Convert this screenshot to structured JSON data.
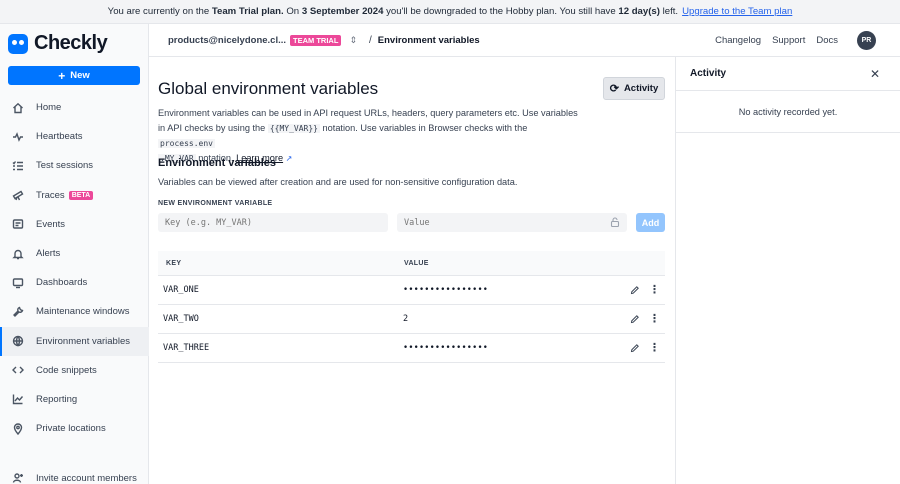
{
  "banner": {
    "t1": "You are currently on the",
    "plan": "Team Trial plan.",
    "t2": "On",
    "date": "3 September 2024",
    "t3": "you'll be downgraded to the Hobby plan. You still have",
    "days": "12 day(s)",
    "t4": "left.",
    "link": "Upgrade to the Team plan"
  },
  "brand": {
    "name": "Checkly"
  },
  "sidebar": {
    "new_label": "New",
    "items": [
      {
        "label": "Home",
        "icon": "home-icon"
      },
      {
        "label": "Heartbeats",
        "icon": "pulse-icon"
      },
      {
        "label": "Test sessions",
        "icon": "list-check-icon"
      },
      {
        "label": "Traces",
        "icon": "telescope-icon",
        "badge": "BETA"
      },
      {
        "label": "Events",
        "icon": "events-icon"
      },
      {
        "label": "Alerts",
        "icon": "bell-icon"
      },
      {
        "label": "Dashboards",
        "icon": "monitor-icon"
      },
      {
        "label": "Maintenance windows",
        "icon": "wrench-icon"
      },
      {
        "label": "Environment variables",
        "icon": "globe-icon",
        "active": true
      },
      {
        "label": "Code snippets",
        "icon": "code-icon"
      },
      {
        "label": "Reporting",
        "icon": "chart-line-icon"
      },
      {
        "label": "Private locations",
        "icon": "location-pin-icon"
      }
    ],
    "invite_label": "Invite account members"
  },
  "topbar": {
    "account": "products@nicelydone.cl...",
    "trial_badge": "TEAM TRIAL",
    "separator": "/",
    "crumb": "Environment variables",
    "links": [
      "Changelog",
      "Support",
      "Docs"
    ],
    "avatar": "PR"
  },
  "main": {
    "title": "Global environment variables",
    "activity_button": "Activity",
    "desc": {
      "p1": "Environment variables can be used in API request URLs, headers, query parameters etc. Use variables in API checks by using the",
      "code1": "{{MY_VAR}}",
      "p2": "notation. Use variables in Browser checks with the",
      "code2": "process.env",
      "code3": ".MY_VAR",
      "p3": "notation.",
      "learn": "Learn more"
    },
    "section_title": "Environment variables",
    "section_sub": "Variables can be viewed after creation and are used for non-sensitive configuration data.",
    "new_var_label": "NEW ENVIRONMENT VARIABLE",
    "key_placeholder": "Key (e.g. MY_VAR)",
    "value_placeholder": "Value",
    "add_button": "Add",
    "table": {
      "headers": {
        "key": "KEY",
        "value": "VALUE"
      },
      "rows": [
        {
          "key": "VAR_ONE",
          "value": "••••••••••••••••"
        },
        {
          "key": "VAR_TWO",
          "value": "2"
        },
        {
          "key": "VAR_THREE",
          "value": "••••••••••••••••"
        }
      ]
    }
  },
  "panel": {
    "title": "Activity",
    "empty": "No activity recorded yet."
  }
}
